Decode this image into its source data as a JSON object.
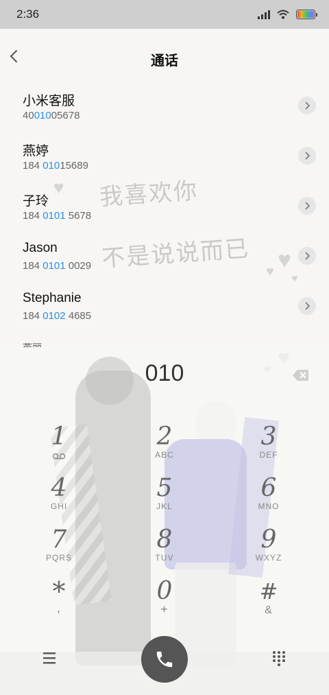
{
  "status_bar": {
    "time": "2:36"
  },
  "header": {
    "title": "通话"
  },
  "watermark": {
    "line1": "我喜欢你",
    "line2": "不是说说而已"
  },
  "contacts": [
    {
      "name": "小米客服",
      "num_pre": "40",
      "num_hl": "010",
      "num_post": "05678"
    },
    {
      "name": "燕婷",
      "num_pre": "184 ",
      "num_hl": "010",
      "num_post": "15689"
    },
    {
      "name": "子玲",
      "num_pre": "184 ",
      "num_hl": "0101",
      "num_post": " 5678"
    },
    {
      "name": "Jason",
      "num_pre": "184 ",
      "num_hl": "0101",
      "num_post": " 0029"
    },
    {
      "name": "Stephanie",
      "num_pre": "184 ",
      "num_hl": "0102",
      "num_post": " 4685"
    }
  ],
  "partial_contact": {
    "name": "燕丽"
  },
  "dial_input": "010",
  "keypad": [
    {
      "digit": "1",
      "letters": ""
    },
    {
      "digit": "2",
      "letters": "ABC"
    },
    {
      "digit": "3",
      "letters": "DEF"
    },
    {
      "digit": "4",
      "letters": "GHI"
    },
    {
      "digit": "5",
      "letters": "JKL"
    },
    {
      "digit": "6",
      "letters": "MNO"
    },
    {
      "digit": "7",
      "letters": "PQRS"
    },
    {
      "digit": "8",
      "letters": "TUV"
    },
    {
      "digit": "9",
      "letters": "WXYZ"
    },
    {
      "digit": "*",
      "letters": ","
    },
    {
      "digit": "0",
      "letters": "+"
    },
    {
      "digit": "#",
      "letters": "&"
    }
  ],
  "icons": {
    "back": "chevron-left-icon",
    "row_action": "chevron-right-icon",
    "delete": "backspace-icon",
    "menu": "hamburger-icon",
    "call": "phone-icon",
    "keypad": "dialpad-icon",
    "voicemail": "voicemail-icon"
  },
  "colors": {
    "highlight": "#2a8fe0",
    "call_button": "#555555",
    "status_bar": "#cfcfcf"
  }
}
